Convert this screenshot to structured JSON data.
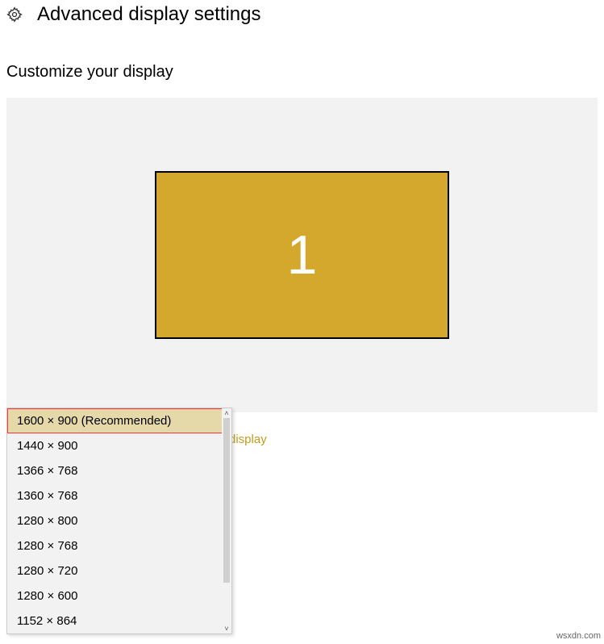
{
  "header": {
    "title": "Advanced display settings"
  },
  "subtitle": "Customize your display",
  "monitor": {
    "number": "1"
  },
  "link": {
    "partial_text": "display"
  },
  "resolution_dropdown": {
    "selected_index": 0,
    "options": [
      "1600 × 900 (Recommended)",
      "1440 × 900",
      "1366 × 768",
      "1360 × 768",
      "1280 × 800",
      "1280 × 768",
      "1280 × 720",
      "1280 × 600",
      "1152 × 864"
    ]
  },
  "watermark": "wsxdn.com"
}
